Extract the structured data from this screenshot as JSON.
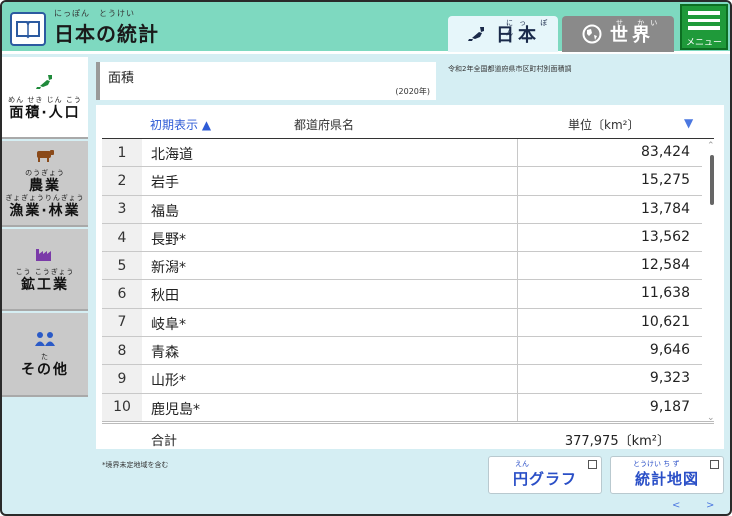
{
  "header": {
    "title_ruby": "にっぽん　とうけい",
    "title": "日本の統計",
    "tab_japan": {
      "ruby": "にっ ぽん",
      "label": "日本"
    },
    "tab_world": {
      "ruby": "せ かい",
      "label": "世界"
    },
    "menu_label": "メニュー"
  },
  "sidebar": {
    "items": [
      {
        "ruby": "めん せき じん こう",
        "label": "面積·人口",
        "icon": "japan-map-icon",
        "active": true
      },
      {
        "ruby1": "のうぎょう",
        "label1": "農業",
        "ruby2": "ぎょぎょうりんぎょう",
        "label2": "漁業·林業",
        "icon": "cow-icon"
      },
      {
        "ruby": "こう こうぎょう",
        "label": "鉱工業",
        "icon": "factory-icon"
      },
      {
        "ruby": "た",
        "label": "その他",
        "icon": "people-icon"
      }
    ]
  },
  "content": {
    "title": "面積",
    "year": "(2020年)",
    "source": "令和2年全国都道府県市区町村別面積調",
    "columns": {
      "sort": "初期表示 ▲",
      "prefecture": "都道府県名",
      "unit": "単位〔km²〕",
      "caret": "▼"
    },
    "rows": [
      {
        "rank": "1",
        "pref": "北海道",
        "value": "83,424"
      },
      {
        "rank": "2",
        "pref": "岩手",
        "value": "15,275"
      },
      {
        "rank": "3",
        "pref": "福島",
        "value": "13,784"
      },
      {
        "rank": "4",
        "pref": "長野*",
        "value": "13,562"
      },
      {
        "rank": "5",
        "pref": "新潟*",
        "value": "12,584"
      },
      {
        "rank": "6",
        "pref": "秋田",
        "value": "11,638"
      },
      {
        "rank": "7",
        "pref": "岐阜*",
        "value": "10,621"
      },
      {
        "rank": "8",
        "pref": "青森",
        "value": "9,646"
      },
      {
        "rank": "9",
        "pref": "山形*",
        "value": "9,323"
      },
      {
        "rank": "10",
        "pref": "鹿児島*",
        "value": "9,187"
      }
    ],
    "total_label": "合計",
    "total_value": "377,975〔km²〕",
    "note": "*境界未定地域を含む"
  },
  "buttons": {
    "pie": {
      "ruby": "えん",
      "label": "円グラフ"
    },
    "map": {
      "ruby": "とうけい ち ず",
      "label": "統計地図"
    }
  },
  "pager": {
    "prev": "<",
    "next": ">"
  },
  "colors": {
    "header": "#7ed9c0",
    "menu": "#1f9a3a",
    "accent": "#2a4fc7",
    "background": "#d5eef3"
  }
}
